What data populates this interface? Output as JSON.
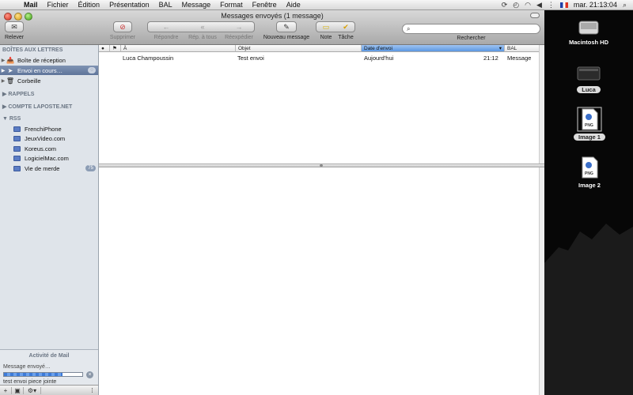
{
  "menubar": {
    "items": [
      "Mail",
      "Fichier",
      "Édition",
      "Présentation",
      "BAL",
      "Message",
      "Format",
      "Fenêtre",
      "Aide"
    ],
    "clock": "mar. 21:13:04"
  },
  "window": {
    "title": "Messages envoyés (1 message)"
  },
  "toolbar": {
    "relever": "Relever",
    "supprimer": "Supprimer",
    "repondre": "Répondre",
    "rep_tous": "Rép. à tous",
    "reexpedier": "Réexpédier",
    "nouveau": "Nouveau message",
    "note": "Note",
    "tache": "Tâche",
    "search_label": "Rechercher",
    "search_placeholder": ""
  },
  "sidebar": {
    "sections": {
      "boites": "BOÎTES AUX LETTRES",
      "rappels": "RAPPELS",
      "compte": "COMPTE LAPOSTE.NET",
      "rss": "RSS"
    },
    "mailboxes": [
      {
        "label": "Boîte de réception",
        "icon": "inbox-icon"
      },
      {
        "label": "Envoi en cours…",
        "icon": "send-icon",
        "selected": true
      },
      {
        "label": "Corbeille",
        "icon": "trash-icon"
      }
    ],
    "rss_feeds": [
      {
        "label": "FrenchiPhone"
      },
      {
        "label": "JeuxVideo.com"
      },
      {
        "label": "Koreus.com"
      },
      {
        "label": "LogicielMac.com"
      },
      {
        "label": "Vie de merde",
        "badge": "75"
      }
    ]
  },
  "activity": {
    "title": "Activité de Mail",
    "status": "Message envoyé…",
    "file": "test envoi piece jointe",
    "progress": 0.75
  },
  "message_list": {
    "columns": [
      "●",
      "⚑",
      "À",
      "Objet",
      "Date d'envoi",
      "BAL"
    ],
    "rows": [
      {
        "to": "Luca Champoussin",
        "subject": "Test envoi",
        "date": "Aujourd'hui",
        "time": "21:12",
        "mailbox": "Message"
      }
    ]
  },
  "desktop": {
    "icons": [
      {
        "label": "Macintosh HD",
        "icon": "hard-drive-icon"
      },
      {
        "label": "Luca",
        "icon": "drive-icon"
      },
      {
        "label": "Image 1",
        "icon": "png-file-icon"
      },
      {
        "label": "Image 2",
        "icon": "png-file-icon"
      }
    ]
  }
}
